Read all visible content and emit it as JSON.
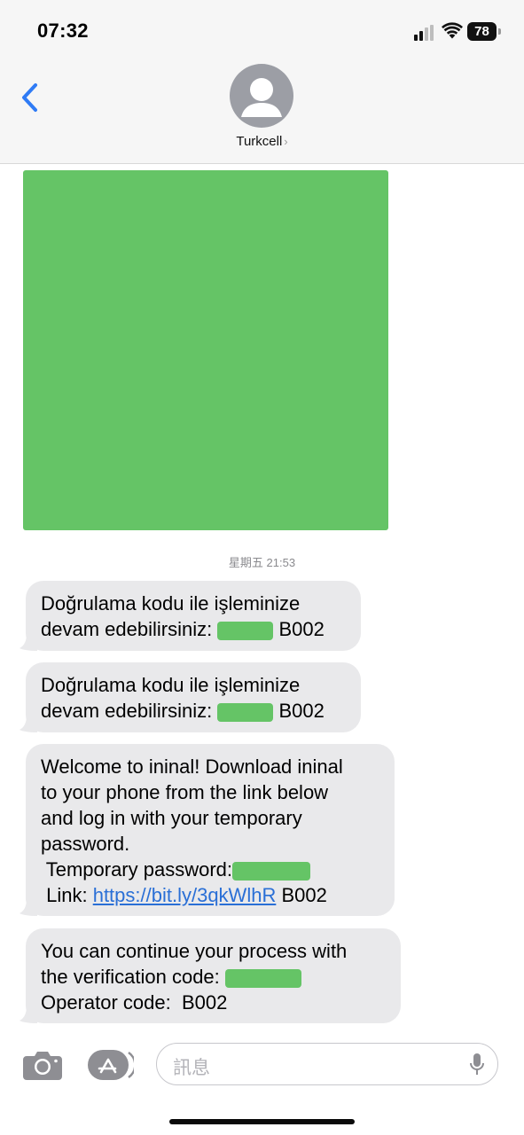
{
  "status_bar": {
    "time": "07:32",
    "battery": "78"
  },
  "header": {
    "contact_name": "Turkcell",
    "chevron": "›",
    "back_icon": "chevron-left-icon",
    "avatar_icon": "person-icon"
  },
  "conversation": {
    "timestamp": "星期五 21:53",
    "messages": [
      {
        "line1": "Doğrulama kodu ile işleminize",
        "line2_prefix": "devam edebilirsiniz:",
        "line2_suffix": "B002"
      },
      {
        "line1": "Doğrulama kodu ile işleminize",
        "line2_prefix": "devam edebilirsiniz:",
        "line2_suffix": "B002"
      },
      {
        "line1": "Welcome to ininal! Download ininal",
        "line2": "to your phone from the link below",
        "line3": "and log in with your temporary",
        "line4": "password.",
        "line5_prefix": " Temporary password:",
        "line6_prefix": " Link: ",
        "link": "https://bit.ly/3qkWlhR",
        "line6_suffix": " B002"
      },
      {
        "line1": "You can continue your process with",
        "line2_prefix": "the verification code: ",
        "line3": "Operator code:  B002"
      }
    ]
  },
  "input_bar": {
    "placeholder": "訊息",
    "camera_icon": "camera-icon",
    "appstore_icon": "app-store-icon",
    "mic_icon": "microphone-icon"
  },
  "colors": {
    "bubble_gray": "#e9e9eb",
    "redaction_green": "#65c466",
    "link_blue": "#2a6fd6",
    "ios_blue": "#2f7bf5"
  }
}
